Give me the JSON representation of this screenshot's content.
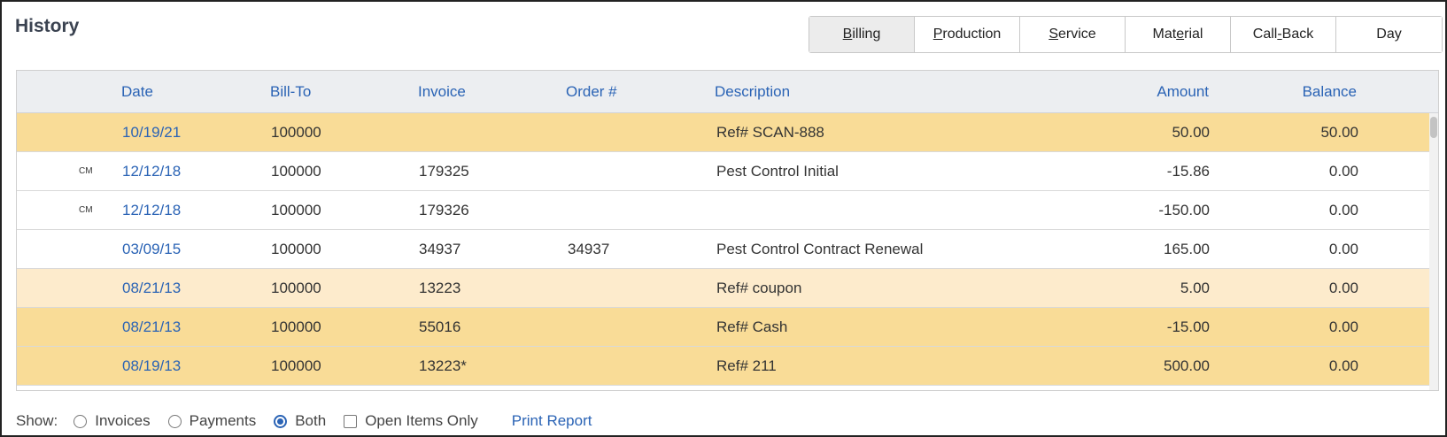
{
  "page": {
    "title": "History"
  },
  "tabs": [
    {
      "pre": "",
      "ul": "B",
      "post": "illing",
      "active": true
    },
    {
      "pre": "",
      "ul": "P",
      "post": "roduction",
      "active": false
    },
    {
      "pre": "",
      "ul": "S",
      "post": "ervice",
      "active": false
    },
    {
      "pre": "Mat",
      "ul": "e",
      "post": "rial",
      "active": false
    },
    {
      "pre": "Call",
      "ul": "-",
      "post": "Back",
      "active": false
    },
    {
      "pre": "",
      "ul": "",
      "post": "Day",
      "active": false
    }
  ],
  "table": {
    "columns": {
      "date": "Date",
      "bill_to": "Bill-To",
      "invoice": "Invoice",
      "order": "Order #",
      "description": "Description",
      "amount": "Amount",
      "balance": "Balance"
    },
    "rows": [
      {
        "tag": "",
        "date": "10/19/21",
        "bill_to": "100000",
        "invoice": "",
        "order": "",
        "description": "Ref# SCAN-888",
        "amount": "50.00",
        "balance": "50.00",
        "style": "hl"
      },
      {
        "tag": "CM",
        "date": "12/12/18",
        "bill_to": "100000",
        "invoice": "179325",
        "order": "",
        "description": "Pest Control Initial",
        "amount": "-15.86",
        "balance": "0.00",
        "style": ""
      },
      {
        "tag": "CM",
        "date": "12/12/18",
        "bill_to": "100000",
        "invoice": "179326",
        "order": "",
        "description": "",
        "amount": "-150.00",
        "balance": "0.00",
        "style": ""
      },
      {
        "tag": "",
        "date": "03/09/15",
        "bill_to": "100000",
        "invoice": "34937",
        "order": "34937",
        "description": "Pest Control Contract Renewal",
        "amount": "165.00",
        "balance": "0.00",
        "style": ""
      },
      {
        "tag": "",
        "date": "08/21/13",
        "bill_to": "100000",
        "invoice": "13223",
        "order": "",
        "description": "Ref# coupon",
        "amount": "5.00",
        "balance": "0.00",
        "style": "lt"
      },
      {
        "tag": "",
        "date": "08/21/13",
        "bill_to": "100000",
        "invoice": "55016",
        "order": "",
        "description": "Ref# Cash",
        "amount": "-15.00",
        "balance": "0.00",
        "style": "hl"
      },
      {
        "tag": "",
        "date": "08/19/13",
        "bill_to": "100000",
        "invoice": "13223*",
        "order": "",
        "description": "Ref# 211",
        "amount": "500.00",
        "balance": "0.00",
        "style": "hl"
      }
    ]
  },
  "footer": {
    "show_label": "Show:",
    "options": [
      {
        "label": "Invoices",
        "selected": false
      },
      {
        "label": "Payments",
        "selected": false
      },
      {
        "label": "Both",
        "selected": true
      }
    ],
    "open_items_label": "Open Items Only",
    "open_items_checked": false,
    "print_report": "Print Report"
  }
}
